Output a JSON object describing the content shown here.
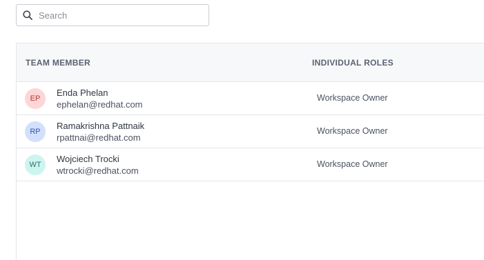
{
  "search": {
    "placeholder": "Search",
    "value": ""
  },
  "table": {
    "headers": {
      "member": "TEAM MEMBER",
      "roles": "INDIVIDUAL ROLES"
    },
    "rows": [
      {
        "initials": "EP",
        "name": "Enda Phelan",
        "email": "ephelan@redhat.com",
        "role": "Workspace Owner",
        "avatar_bg": "#fdd6d6",
        "avatar_fg": "#b23b3b"
      },
      {
        "initials": "RP",
        "name": "Ramakrishna Pattnaik",
        "email": "rpattnai@redhat.com",
        "role": "Workspace Owner",
        "avatar_bg": "#d3e0fb",
        "avatar_fg": "#2f57a8"
      },
      {
        "initials": "WT",
        "name": "Wojciech Trocki",
        "email": "wtrocki@redhat.com",
        "role": "Workspace Owner",
        "avatar_bg": "#cdf5ef",
        "avatar_fg": "#2a6f67"
      }
    ]
  },
  "icons": {
    "search": "search-icon"
  }
}
